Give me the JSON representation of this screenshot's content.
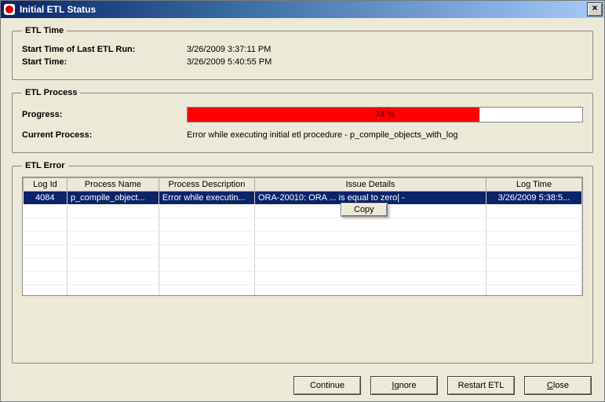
{
  "window": {
    "title": "Initial ETL Status",
    "close_symbol": "×"
  },
  "etl_time": {
    "legend": "ETL Time",
    "last_run_label": "Start Time of Last ETL Run:",
    "last_run_value": "3/26/2009 3:37:11 PM",
    "start_time_label": "Start Time:",
    "start_time_value": "3/26/2009 5:40:55 PM"
  },
  "etl_process": {
    "legend": "ETL Process",
    "progress_label": "Progress:",
    "progress_percent": 74,
    "progress_text": "74 %",
    "current_process_label": "Current Process:",
    "current_process_value": "Error while executing initial etl procedure - p_compile_objects_with_log"
  },
  "etl_error": {
    "legend": "ETL Error",
    "columns": {
      "log_id": "Log Id",
      "process_name": "Process Name",
      "process_description": "Process Description",
      "issue_details": "Issue Details",
      "log_time": "Log Time"
    },
    "rows": [
      {
        "log_id": "4084",
        "process_name": "p_compile_object...",
        "process_description": "Error while executin...",
        "issue_details": "ORA-20010: ORA ... is equal to zero| - ",
        "log_time": "3/26/2009 5:38:5..."
      }
    ],
    "context_menu": {
      "copy": "Copy"
    }
  },
  "buttons": {
    "continue": "Continue",
    "ignore": "Ignore",
    "restart": "Restart ETL",
    "close": "Close"
  }
}
